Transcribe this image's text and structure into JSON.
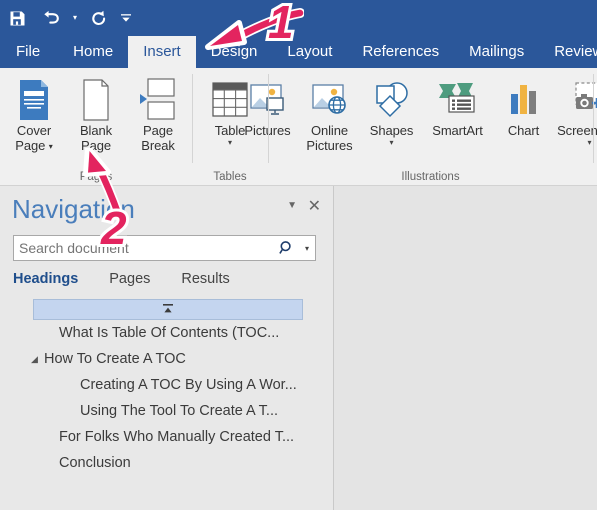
{
  "window": {
    "accent_color": "#2b579a",
    "ribbon_bg": "#f0f0f0"
  },
  "quick_access": {
    "items": [
      {
        "name": "save-icon",
        "label": "Save"
      },
      {
        "name": "undo-icon",
        "label": "Undo"
      },
      {
        "name": "redo-icon",
        "label": "Redo"
      },
      {
        "name": "customize-qat-icon",
        "label": "Customize Quick Access Toolbar"
      }
    ]
  },
  "ribbon": {
    "tabs": [
      {
        "label": "File",
        "active": false
      },
      {
        "label": "Home",
        "active": false
      },
      {
        "label": "Insert",
        "active": true
      },
      {
        "label": "Design",
        "active": false
      },
      {
        "label": "Layout",
        "active": false
      },
      {
        "label": "References",
        "active": false
      },
      {
        "label": "Mailings",
        "active": false
      },
      {
        "label": "Review",
        "active": false
      }
    ],
    "groups": [
      {
        "label": "Pages",
        "buttons": [
          {
            "name": "cover-page-button",
            "line1": "Cover",
            "line2": "Page",
            "dropdown": "inline",
            "icon": "cover-page-icon"
          },
          {
            "name": "blank-page-button",
            "line1": "Blank",
            "line2": "Page",
            "dropdown": "none",
            "icon": "blank-page-icon"
          },
          {
            "name": "page-break-button",
            "line1": "Page",
            "line2": "Break",
            "dropdown": "none",
            "icon": "page-break-icon"
          }
        ]
      },
      {
        "label": "Tables",
        "buttons": [
          {
            "name": "table-button",
            "line1": "Table",
            "line2": "",
            "dropdown": "below",
            "icon": "table-icon"
          }
        ]
      },
      {
        "label": "Illustrations",
        "buttons": [
          {
            "name": "pictures-button",
            "line1": "Pictures",
            "line2": "",
            "dropdown": "none",
            "icon": "pictures-icon"
          },
          {
            "name": "online-pictures-button",
            "line1": "Online",
            "line2": "Pictures",
            "dropdown": "none",
            "icon": "online-pictures-icon"
          },
          {
            "name": "shapes-button",
            "line1": "Shapes",
            "line2": "",
            "dropdown": "below",
            "icon": "shapes-icon"
          },
          {
            "name": "smartart-button",
            "line1": "SmartArt",
            "line2": "",
            "dropdown": "none",
            "icon": "smartart-icon"
          },
          {
            "name": "chart-button",
            "line1": "Chart",
            "line2": "",
            "dropdown": "none",
            "icon": "chart-icon"
          },
          {
            "name": "screenshot-button",
            "line1": "Screenshot",
            "line2": "",
            "dropdown": "below",
            "icon": "screenshot-icon"
          }
        ]
      },
      {
        "label": "",
        "buttons": [
          {
            "name": "store-addins-button",
            "line1": "",
            "line2": "",
            "dropdown": "none",
            "icon": "store-icon"
          },
          {
            "name": "my-addins-button",
            "line1": "",
            "line2": "",
            "dropdown": "none",
            "icon": "my-addins-icon"
          }
        ]
      }
    ]
  },
  "navigation": {
    "title": "Navigation",
    "collapse_icon": "chevron-down-icon",
    "close_icon": "close-icon",
    "search": {
      "value": "",
      "placeholder": "Search document",
      "icon": "search-icon",
      "dropdown_icon": "chevron-down-icon"
    },
    "tabs": [
      {
        "label": "Headings",
        "active": true
      },
      {
        "label": "Pages",
        "active": false
      },
      {
        "label": "Results",
        "active": false
      }
    ],
    "headings": [
      {
        "label": "",
        "indent": 1,
        "selected": true,
        "twisty": "none",
        "glyph": "collapse-glyph"
      },
      {
        "label": "What Is Table Of Contents (TOC...",
        "indent": 1,
        "selected": false,
        "twisty": "none"
      },
      {
        "label": "How To Create A TOC",
        "indent": 1,
        "selected": false,
        "twisty": "expanded"
      },
      {
        "label": "Creating A TOC By Using A Wor...",
        "indent": 2,
        "selected": false,
        "twisty": "none"
      },
      {
        "label": "Using The Tool To Create A T...",
        "indent": 2,
        "selected": false,
        "twisty": "none"
      },
      {
        "label": "For Folks Who Manually Created T...",
        "indent": 1,
        "selected": false,
        "twisty": "none"
      },
      {
        "label": "Conclusion",
        "indent": 1,
        "selected": false,
        "twisty": "none"
      }
    ]
  },
  "annotations": [
    {
      "name": "step-marker-1",
      "label": "1",
      "target": "Insert tab",
      "color": "#e3245f"
    },
    {
      "name": "step-marker-2",
      "label": "2",
      "target": "Blank Page button",
      "color": "#e3245f"
    }
  ]
}
